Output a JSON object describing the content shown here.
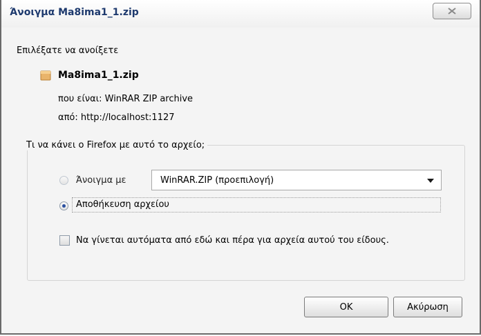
{
  "window": {
    "title": "Άνοιγμα Ma8ima1_1.zip"
  },
  "dialog": {
    "intro": "Επιλέξατε να ανοίξετε",
    "file_name": "Ma8ima1_1.zip",
    "type_label": "που είναι:",
    "type_value": "WinRAR ZIP archive",
    "from_label": "από:",
    "from_value": "http://localhost:1127"
  },
  "action_group": {
    "legend": "Τι να κάνει ο Firefox  με αυτό το αρχείο;",
    "open_with_label": "Άνοιγμα με",
    "open_with_selected": "WinRAR.ZIP (προεπιλογή)",
    "save_label": "Αποθήκευση αρχείου",
    "auto_label": "Να γίνεται αυτόματα από εδώ και πέρα για αρχεία αυτού του είδους."
  },
  "buttons": {
    "ok": "OK",
    "cancel": "Ακύρωση"
  },
  "state": {
    "selected_option": "save",
    "auto_checked": false
  }
}
